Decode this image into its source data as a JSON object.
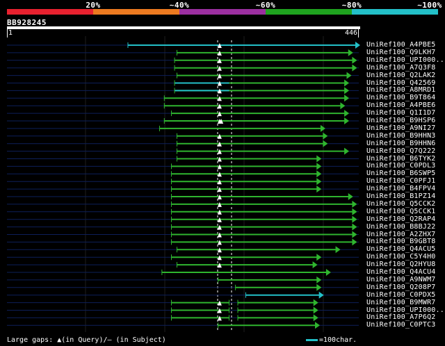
{
  "legend": [
    {
      "label": "",
      "color": "#e8212f"
    },
    {
      "label": "20%",
      "color": "#ec7a20"
    },
    {
      "label": "~40%",
      "color": "#9b2fa0"
    },
    {
      "label": "~60%",
      "color": "#1fa31f"
    },
    {
      "label": "~80%",
      "color": "#23c0c8"
    },
    {
      "label": "~100%",
      "color": ""
    }
  ],
  "query": {
    "id": "BB928245",
    "start": "1",
    "end": "446",
    "length": 446
  },
  "colors": {
    "green": "#2fb52f",
    "cyan": "#23c0c8",
    "gap": "#0d1f5a",
    "marker": "#ffffff"
  },
  "hits": [
    {
      "name": "UniRef100_A4PBE5",
      "start": 154,
      "end": 446,
      "color": "cyan",
      "gap_at": 270
    },
    {
      "name": "UniRef100_Q9LKH7",
      "start": 216,
      "end": 437,
      "color": "green",
      "gap_at": 270
    },
    {
      "name": "UniRef100_UPI000..",
      "start": 213,
      "end": 442,
      "color": "green",
      "gap_at": 270
    },
    {
      "name": "UniRef100_A7Q3F8",
      "start": 213,
      "end": 442,
      "color": "green",
      "gap_at": 270
    },
    {
      "name": "UniRef100_Q2LAK2",
      "start": 216,
      "end": 435,
      "color": "green",
      "gap_at": 270
    },
    {
      "name": "UniRef100_Q42569",
      "start": 213,
      "end": 432,
      "color": "green",
      "gap_at": 270,
      "cyan_end": 282
    },
    {
      "name": "UniRef100_A8MRD1",
      "start": 213,
      "end": 432,
      "color": "green",
      "gap_at": 270,
      "cyan_end": 282
    },
    {
      "name": "UniRef100_B9T864",
      "start": 200,
      "end": 432,
      "color": "green",
      "gap_at": 270
    },
    {
      "name": "UniRef100_A4PBE6",
      "start": 200,
      "end": 427,
      "color": "green",
      "gap_at": 270
    },
    {
      "name": "UniRef100_Q1I1D7",
      "start": 209,
      "end": 432,
      "color": "green",
      "gap_at": 270
    },
    {
      "name": "UniRef100_B9HSP6",
      "start": 200,
      "end": 432,
      "color": "green",
      "gap_at": 270,
      "mid_marker": 272
    },
    {
      "name": "UniRef100_A9NI27",
      "start": 194,
      "end": 402,
      "color": "green",
      "gap_at": 0
    },
    {
      "name": "UniRef100_B9HHN3",
      "start": 216,
      "end": 405,
      "color": "green",
      "gap_at": 270
    },
    {
      "name": "UniRef100_B9HHN6",
      "start": 216,
      "end": 405,
      "color": "green",
      "gap_at": 270
    },
    {
      "name": "UniRef100_Q7Q222",
      "start": 216,
      "end": 432,
      "color": "green",
      "gap_at": 270
    },
    {
      "name": "UniRef100_B6TYK2",
      "start": 216,
      "end": 397,
      "color": "green",
      "gap_at": 270
    },
    {
      "name": "UniRef100_C0PDL3",
      "start": 209,
      "end": 397,
      "color": "green",
      "gap_at": 270
    },
    {
      "name": "UniRef100_B6SWP5",
      "start": 209,
      "end": 397,
      "color": "green",
      "gap_at": 270
    },
    {
      "name": "UniRef100_C0PFJ1",
      "start": 209,
      "end": 397,
      "color": "green",
      "gap_at": 270
    },
    {
      "name": "UniRef100_B4FPV4",
      "start": 209,
      "end": 397,
      "color": "green",
      "gap_at": 270
    },
    {
      "name": "UniRef100_B1PZ14",
      "start": 209,
      "end": 437,
      "color": "green",
      "gap_at": 270
    },
    {
      "name": "UniRef100_Q5CCK2",
      "start": 209,
      "end": 442,
      "color": "green",
      "gap_at": 270
    },
    {
      "name": "UniRef100_Q5CCK1",
      "start": 209,
      "end": 442,
      "color": "green",
      "gap_at": 270
    },
    {
      "name": "UniRef100_Q2RAP4",
      "start": 209,
      "end": 442,
      "color": "green",
      "gap_at": 270
    },
    {
      "name": "UniRef100_B8BJ22",
      "start": 209,
      "end": 442,
      "color": "green",
      "gap_at": 270
    },
    {
      "name": "UniRef100_A2ZHX7",
      "start": 209,
      "end": 442,
      "color": "green",
      "gap_at": 270
    },
    {
      "name": "UniRef100_B9GBT8",
      "start": 209,
      "end": 442,
      "color": "green",
      "gap_at": 270
    },
    {
      "name": "UniRef100_Q4ACU5",
      "start": 216,
      "end": 421,
      "color": "green",
      "gap_at": 270
    },
    {
      "name": "UniRef100_C5Y4H0",
      "start": 209,
      "end": 397,
      "color": "green",
      "gap_at": 270
    },
    {
      "name": "UniRef100_Q2HYU8",
      "start": 216,
      "end": 392,
      "color": "green",
      "gap_at": 270
    },
    {
      "name": "UniRef100_Q4ACU4",
      "start": 197,
      "end": 409,
      "color": "green",
      "gap_at": 0
    },
    {
      "name": "UniRef100_A9NWM7",
      "start": 268,
      "end": 397,
      "color": "green",
      "gap_at": 0
    },
    {
      "name": "UniRef100_Q208P7",
      "start": 290,
      "end": 397,
      "color": "green",
      "gap_at": 0
    },
    {
      "name": "UniRef100_C0PDX5",
      "start": 303,
      "end": 400,
      "color": "cyan",
      "gap_at": 0
    },
    {
      "name": "UniRef100_B9MWR7",
      "start": 209,
      "end": 393,
      "color": "green",
      "gap_at": 270,
      "split": [
        282,
        293
      ]
    },
    {
      "name": "UniRef100_UPI000..",
      "start": 209,
      "end": 393,
      "color": "green",
      "gap_at": 270,
      "split": [
        282,
        293
      ]
    },
    {
      "name": "UniRef100_A7P6Q2",
      "start": 209,
      "end": 393,
      "color": "green",
      "gap_at": 270,
      "split": [
        282,
        293
      ]
    },
    {
      "name": "UniRef100_C0PTC3",
      "start": 268,
      "end": 395,
      "color": "green",
      "gap_at": 0
    }
  ],
  "footer": {
    "left": "Large gaps: ▲(in Query)/— (in Subject)",
    "scale_label": "=100char."
  }
}
